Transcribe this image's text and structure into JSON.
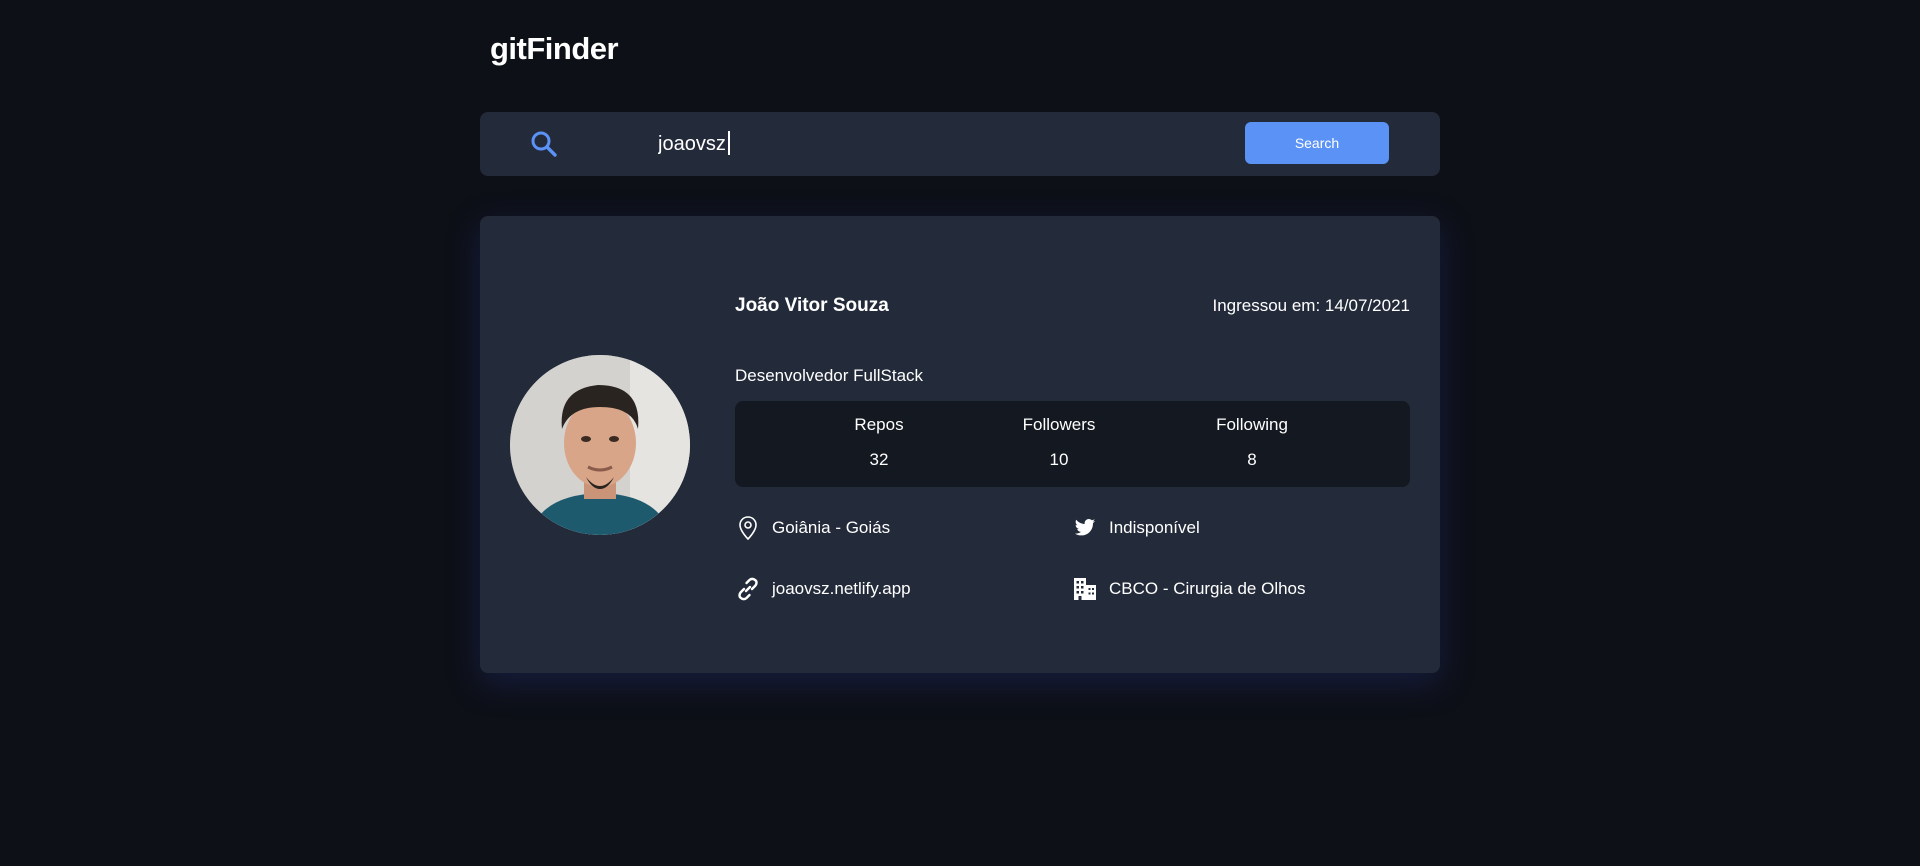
{
  "header": {
    "title": "gitFinder"
  },
  "search": {
    "value": "joaovsz",
    "button_label": "Search",
    "icon": "search-icon"
  },
  "profile": {
    "name": "João Vitor Souza",
    "joined": "Ingressou em: 14/07/2021",
    "bio": "Desenvolvedor FullStack",
    "stats": [
      {
        "label": "Repos",
        "value": "32"
      },
      {
        "label": "Followers",
        "value": "10"
      },
      {
        "label": "Following",
        "value": "8"
      }
    ],
    "location": "Goiânia - Goiás",
    "twitter": "Indisponível",
    "blog": "joaovsz.netlify.app",
    "company": "CBCO - Cirurgia de Olhos"
  },
  "colors": {
    "background": "#0d1017",
    "panel": "#232b3a",
    "stats_panel": "#141820",
    "accent": "#5b92f5"
  }
}
